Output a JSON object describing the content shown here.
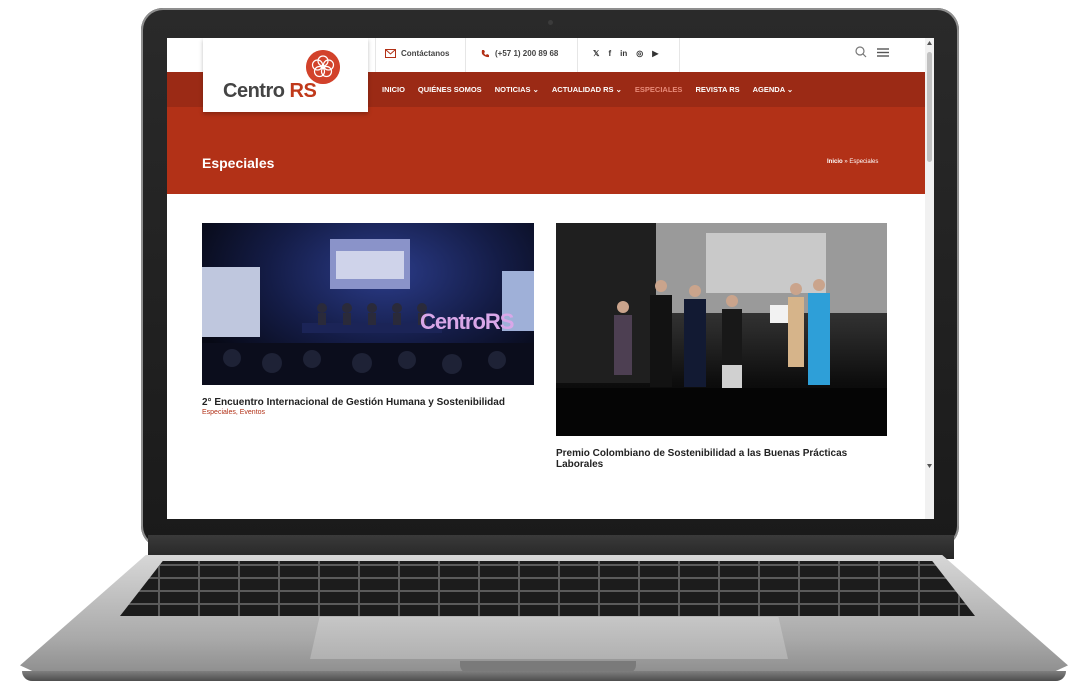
{
  "site": {
    "logo_text": "Centro",
    "logo_accent": "RS",
    "brand_color": "#b23117",
    "nav_color": "#9b2a15"
  },
  "topbar": {
    "contact_label": "Contáctanos",
    "phone": "(+57 1) 200 89 68",
    "social": [
      "𝕏",
      "f",
      "in",
      "◎",
      "▶"
    ],
    "icons": [
      "search-icon",
      "menu-icon"
    ]
  },
  "nav": {
    "items": [
      {
        "label": "INICIO"
      },
      {
        "label": "QUIÉNES SOMOS"
      },
      {
        "label": "NOTICIAS ⌄"
      },
      {
        "label": "ACTUALIDAD RS ⌄"
      },
      {
        "label": "ESPECIALES"
      },
      {
        "label": "REVISTA RS"
      },
      {
        "label": "AGENDA ⌄"
      }
    ],
    "active_index": 4
  },
  "hero": {
    "title": "Especiales",
    "breadcrumb_home": "Inicio",
    "breadcrumb_sep": "»",
    "breadcrumb_current": "Especiales"
  },
  "posts": [
    {
      "title": "2° Encuentro Internacional de Gestión Humana y Sostenibilidad",
      "categories": "Especiales, Eventos",
      "image_caption": "CentroRS"
    },
    {
      "title": "Premio Colombiano de Sostenibilidad a las Buenas Prácticas Laborales"
    }
  ]
}
